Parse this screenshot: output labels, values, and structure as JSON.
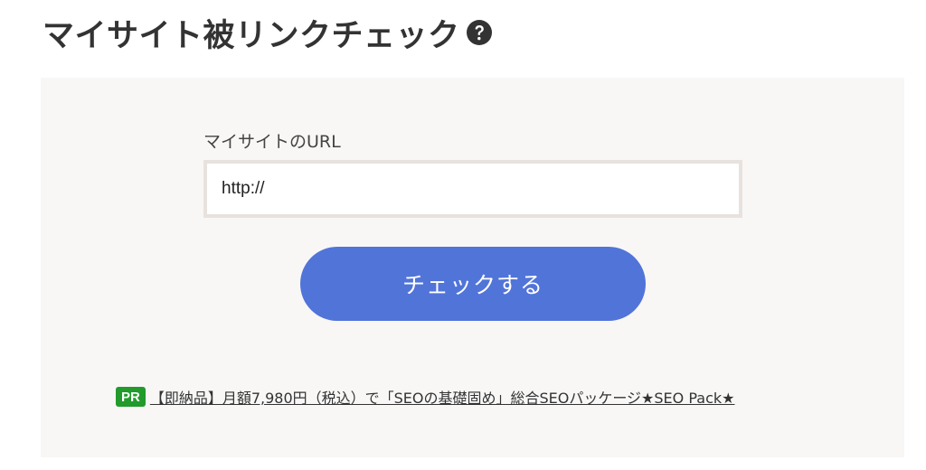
{
  "header": {
    "title": "マイサイト被リンクチェック",
    "help_icon": "question-circle-icon"
  },
  "form": {
    "url_label": "マイサイトのURL",
    "url_value": "http://",
    "submit_label": "チェックする"
  },
  "promo": {
    "badge": "PR",
    "link_text": "【即納品】月額7,980円（税込）で「SEOの基礎固め」総合SEOパッケージ★SEO Pack★"
  },
  "colors": {
    "title": "#333333",
    "panel_background": "#f8f7f6",
    "input_border": "#e8e2df",
    "button": "#5174d9",
    "badge": "#229a2c"
  }
}
